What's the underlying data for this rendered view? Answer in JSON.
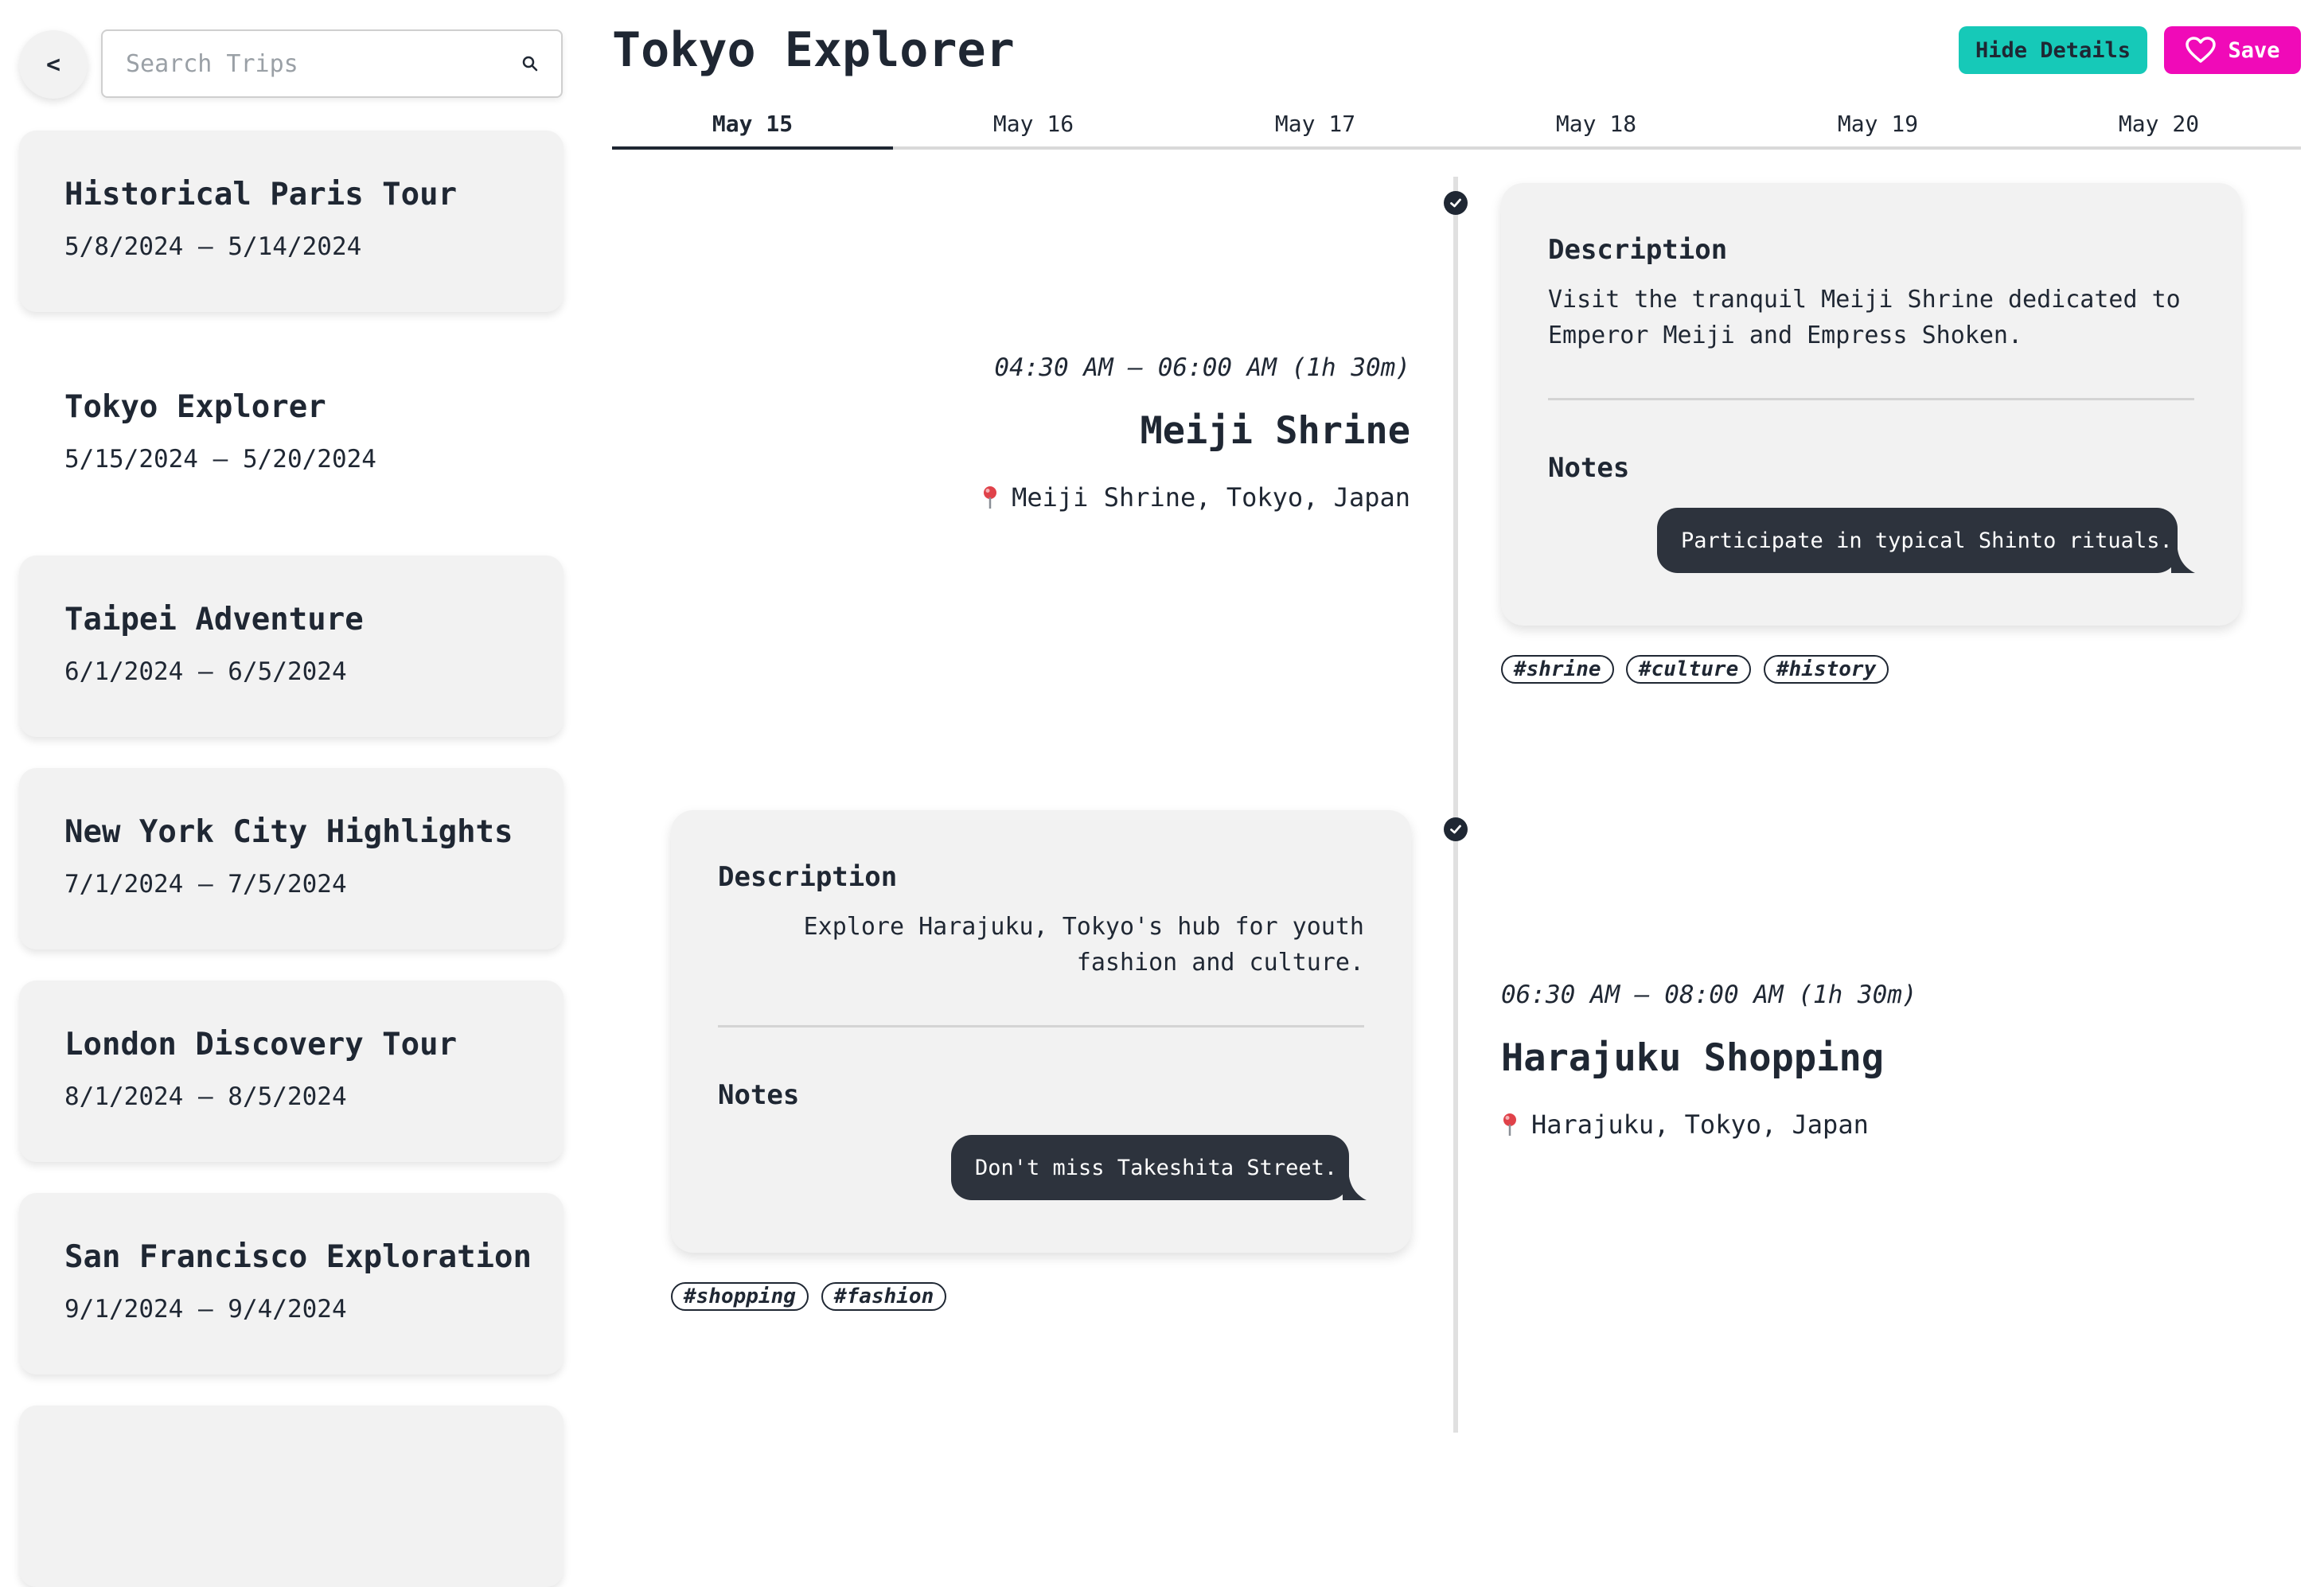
{
  "sidebar": {
    "back_label": "<",
    "search_placeholder": "Search Trips",
    "trips": [
      {
        "name": "Historical Paris Tour",
        "dates": "5/8/2024 – 5/14/2024"
      },
      {
        "name": "Tokyo Explorer",
        "dates": "5/15/2024 – 5/20/2024"
      },
      {
        "name": "Taipei Adventure",
        "dates": "6/1/2024 – 6/5/2024"
      },
      {
        "name": "New York City Highlights",
        "dates": "7/1/2024 – 7/5/2024"
      },
      {
        "name": "London Discovery Tour",
        "dates": "8/1/2024 – 8/5/2024"
      },
      {
        "name": "San Francisco Exploration",
        "dates": "9/1/2024 – 9/4/2024"
      }
    ]
  },
  "header": {
    "title": "Tokyo Explorer",
    "hide_details_label": "Hide Details",
    "save_label": "Save"
  },
  "tabs": [
    "May 15",
    "May 16",
    "May 17",
    "May 18",
    "May 19",
    "May 20"
  ],
  "events": [
    {
      "time": "04:30 AM – 06:00 AM (1h 30m)",
      "title": "Meiji Shrine",
      "location": "Meiji Shrine, Tokyo, Japan",
      "description_heading": "Description",
      "description_line1": "Visit the tranquil Meiji Shrine dedicated to",
      "description_line2": "Emperor Meiji and Empress Shoken.",
      "notes_heading": "Notes",
      "note": "Participate in typical Shinto rituals.",
      "tags": [
        "#shrine",
        "#culture",
        "#history"
      ]
    },
    {
      "time": "06:30 AM – 08:00 AM (1h 30m)",
      "title": "Harajuku Shopping",
      "location": "Harajuku, Tokyo, Japan",
      "description_heading": "Description",
      "description_line1": "Explore Harajuku, Tokyo's hub for youth",
      "description_line2": "fashion and culture.",
      "notes_heading": "Notes",
      "note": "Don't miss Takeshita Street.",
      "tags": [
        "#shopping",
        "#fashion"
      ]
    }
  ],
  "colors": {
    "accent_teal": "#16c9b8",
    "accent_pink": "#f00ab8",
    "dark": "#1f2733",
    "card_bg": "#f2f2f2",
    "bubble_bg": "#2d333d",
    "pin_red": "#e0424a"
  },
  "icons": {
    "search": "search-icon",
    "heart": "heart-icon",
    "check": "check-icon",
    "pin": "map-pin-icon"
  }
}
